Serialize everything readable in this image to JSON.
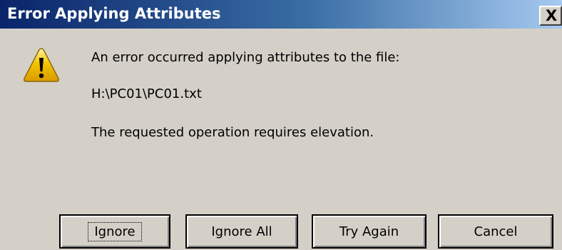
{
  "window": {
    "title": "Error Applying Attributes",
    "close_glyph": "X"
  },
  "dialog": {
    "icon": "warning-icon",
    "message_line1": "An error occurred applying attributes to the file:",
    "file_path": "H:\\PC01\\PC01.txt",
    "detail": "The requested operation requires elevation."
  },
  "buttons": {
    "ignore": "Ignore",
    "ignore_all": "Ignore All",
    "try_again": "Try Again",
    "cancel": "Cancel"
  },
  "colors": {
    "titlebar_start": "#0a246a",
    "titlebar_end": "#a6caf0",
    "dialog_bg": "#d4d0c8",
    "warning_yellow": "#f5c400"
  }
}
